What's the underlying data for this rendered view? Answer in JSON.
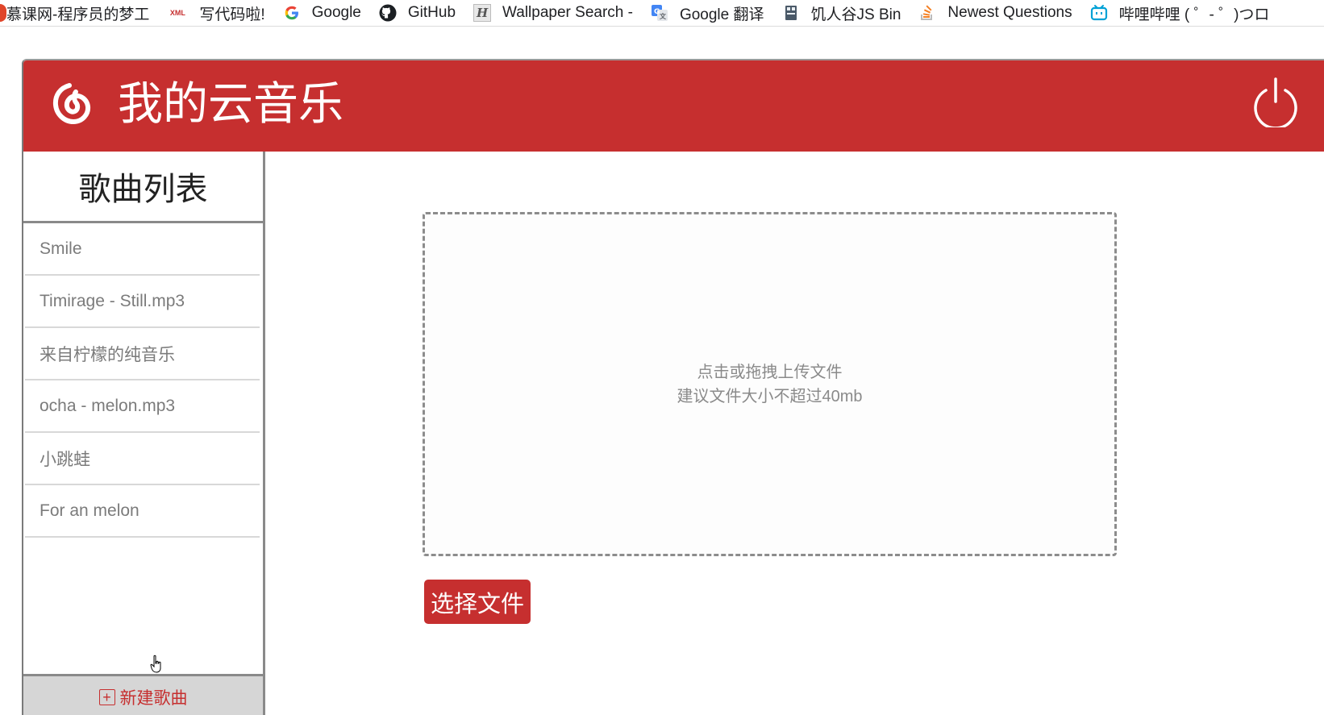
{
  "bookmarks": [
    {
      "label": "慕课网-程序员的梦工",
      "icon": "imooc-icon"
    },
    {
      "label": "写代码啦!",
      "icon": "xml-icon",
      "icon_text": "XML"
    },
    {
      "label": "Google",
      "icon": "google-icon"
    },
    {
      "label": "GitHub",
      "icon": "github-icon"
    },
    {
      "label": "Wallpaper Search -",
      "icon": "wallhaven-icon"
    },
    {
      "label": "Google 翻译",
      "icon": "google-translate-icon"
    },
    {
      "label": "饥人谷JS Bin",
      "icon": "jsbin-icon"
    },
    {
      "label": "Newest Questions",
      "icon": "stackoverflow-icon"
    },
    {
      "label": "哔哩哔哩 ( ゜- ゜)つロ",
      "icon": "bilibili-icon"
    }
  ],
  "header": {
    "title": "我的云音乐",
    "logo_icon": "netease-music-logo-icon",
    "power_icon": "power-icon",
    "color": "#c62f2f"
  },
  "sidebar": {
    "title": "歌曲列表",
    "songs": [
      {
        "label": "Smile"
      },
      {
        "label": "Timirage - Still.mp3"
      },
      {
        "label": "来自柠檬的纯音乐"
      },
      {
        "label": "ocha - melon.mp3"
      },
      {
        "label": "小跳蛙"
      },
      {
        "label": "For an melon"
      }
    ],
    "new_song_label": "新建歌曲",
    "new_song_icon": "plus-square-icon"
  },
  "upload": {
    "line1": "点击或拖拽上传文件",
    "line2": "建议文件大小不超过40mb",
    "button_label": "选择文件"
  }
}
